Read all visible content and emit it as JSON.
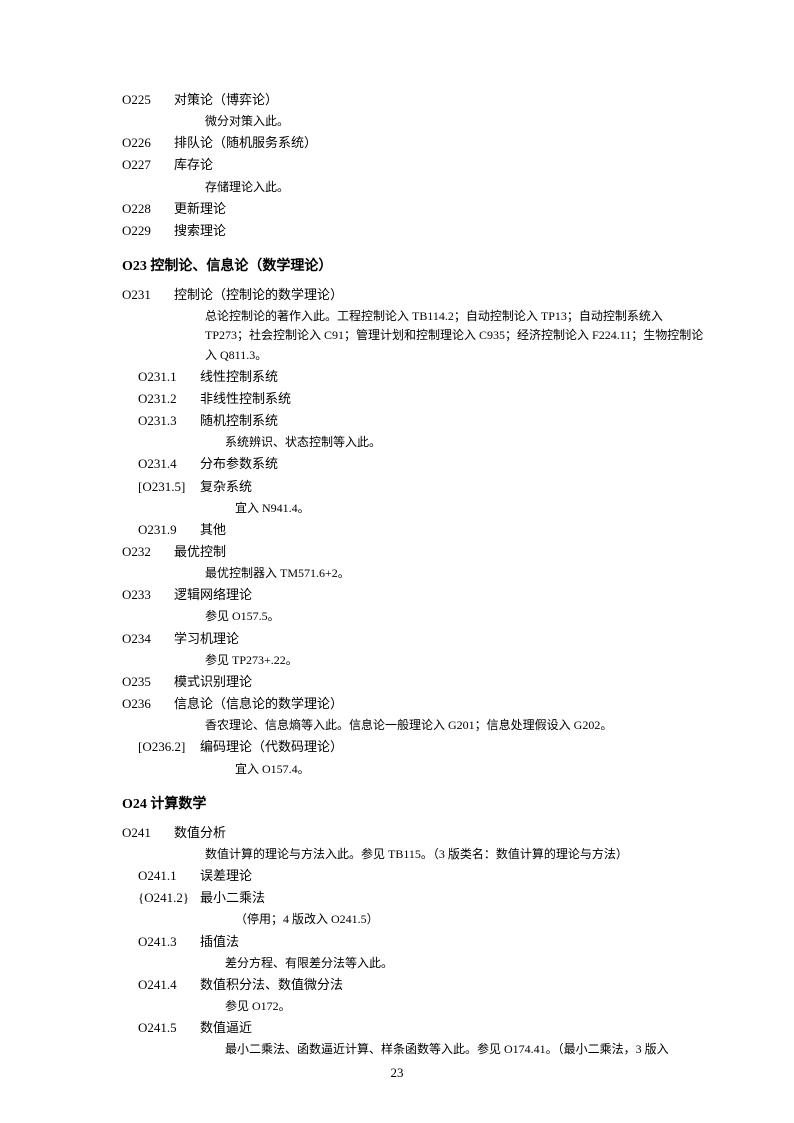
{
  "entries": [
    {
      "type": "entry",
      "level": 1,
      "code": "O225",
      "label": "对策论（博弈论）"
    },
    {
      "type": "note",
      "level": 1,
      "text": "微分对策入此。"
    },
    {
      "type": "entry",
      "level": 1,
      "code": "O226",
      "label": "排队论（随机服务系统）"
    },
    {
      "type": "entry",
      "level": 1,
      "code": "O227",
      "label": "库存论"
    },
    {
      "type": "note",
      "level": 1,
      "text": "存储理论入此。"
    },
    {
      "type": "entry",
      "level": 1,
      "code": "O228",
      "label": "更新理论"
    },
    {
      "type": "entry",
      "level": 1,
      "code": "O229",
      "label": "搜索理论"
    },
    {
      "type": "heading",
      "code": "O23",
      "label": "控制论、信息论（数学理论）"
    },
    {
      "type": "entry",
      "level": 1,
      "code": "O231",
      "label": "控制论（控制论的数学理论）"
    },
    {
      "type": "note",
      "level": 1,
      "text": "总论控制论的著作入此。工程控制论入 TB114.2；自动控制论入 TP13；自动控制系统入TP273；社会控制论入 C91；管理计划和控制理论入 C935；经济控制论入 F224.11；生物控制论入 Q811.3。"
    },
    {
      "type": "entry",
      "level": 2,
      "code": "O231.1",
      "label": "线性控制系统"
    },
    {
      "type": "entry",
      "level": 2,
      "code": "O231.2",
      "label": "非线性控制系统"
    },
    {
      "type": "entry",
      "level": 2,
      "code": "O231.3",
      "label": "随机控制系统"
    },
    {
      "type": "note",
      "level": 2,
      "text": "系统辨识、状态控制等入此。"
    },
    {
      "type": "entry",
      "level": 2,
      "code": "O231.4",
      "label": "分布参数系统"
    },
    {
      "type": "entry",
      "level": 2,
      "code": "[O231.5]",
      "label": "复杂系统"
    },
    {
      "type": "note",
      "level": 3,
      "text": "宜入 N941.4。"
    },
    {
      "type": "entry",
      "level": 2,
      "code": "O231.9",
      "label": "其他"
    },
    {
      "type": "entry",
      "level": 1,
      "code": "O232",
      "label": "最优控制"
    },
    {
      "type": "note",
      "level": 1,
      "text": "最优控制器入 TM571.6+2。"
    },
    {
      "type": "entry",
      "level": 1,
      "code": "O233",
      "label": "逻辑网络理论"
    },
    {
      "type": "note",
      "level": 1,
      "text": "参见 O157.5。"
    },
    {
      "type": "entry",
      "level": 1,
      "code": "O234",
      "label": "学习机理论"
    },
    {
      "type": "note",
      "level": 1,
      "text": "参见 TP273+.22。"
    },
    {
      "type": "entry",
      "level": 1,
      "code": "O235",
      "label": "模式识别理论"
    },
    {
      "type": "entry",
      "level": 1,
      "code": "O236",
      "label": "信息论（信息论的数学理论）"
    },
    {
      "type": "note",
      "level": 1,
      "text": "香农理论、信息熵等入此。信息论一般理论入 G201；信息处理假设入 G202。"
    },
    {
      "type": "entry",
      "level": 2,
      "code": "[O236.2]",
      "label": "编码理论（代数码理论）"
    },
    {
      "type": "note",
      "level": 3,
      "text": "宜入 O157.4。"
    },
    {
      "type": "heading",
      "code": "O24",
      "label": "计算数学"
    },
    {
      "type": "entry",
      "level": 1,
      "code": "O241",
      "label": "数值分析"
    },
    {
      "type": "note",
      "level": 1,
      "text": "数值计算的理论与方法入此。参见 TB115。（3 版类名：数值计算的理论与方法）"
    },
    {
      "type": "entry",
      "level": 2,
      "code": "O241.1",
      "label": "误差理论"
    },
    {
      "type": "entry",
      "level": 2,
      "code": "{O241.2}",
      "label": "最小二乘法"
    },
    {
      "type": "note",
      "level": 3,
      "text": "（停用；4 版改入 O241.5）"
    },
    {
      "type": "entry",
      "level": 2,
      "code": "O241.3",
      "label": "插值法"
    },
    {
      "type": "note",
      "level": 2,
      "text": "差分方程、有限差分法等入此。"
    },
    {
      "type": "entry",
      "level": 2,
      "code": "O241.4",
      "label": "数值积分法、数值微分法"
    },
    {
      "type": "note",
      "level": 2,
      "text": "参见 O172。"
    },
    {
      "type": "entry",
      "level": 2,
      "code": "O241.5",
      "label": "数值逼近"
    },
    {
      "type": "note",
      "level": 2,
      "text": "最小二乘法、函数逼近计算、样条函数等入此。参见 O174.41。（最小二乘法，3 版入"
    }
  ],
  "page_number": "23"
}
